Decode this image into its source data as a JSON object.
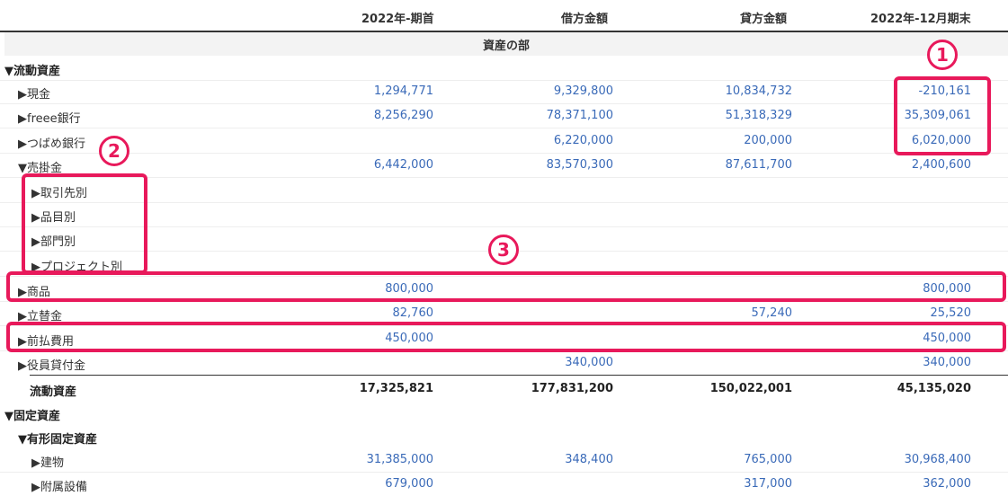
{
  "header": {
    "col1": "2022年-期首",
    "col2": "借方金額",
    "col3": "貸方金額",
    "col4": "2022年-12月期末"
  },
  "section_title": "資産の部",
  "rows": [
    {
      "label": "▼流動資産",
      "v1": "",
      "v2": "",
      "v3": "",
      "v4": ""
    },
    {
      "label": "▶現金",
      "v1": "1,294,771",
      "v2": "9,329,800",
      "v3": "10,834,732",
      "v4": "-210,161"
    },
    {
      "label": "▶freee銀行",
      "v1": "8,256,290",
      "v2": "78,371,100",
      "v3": "51,318,329",
      "v4": "35,309,061"
    },
    {
      "label": "▶つばめ銀行",
      "v1": "",
      "v2": "6,220,000",
      "v3": "200,000",
      "v4": "6,020,000"
    },
    {
      "label": "▼売掛金",
      "v1": "6,442,000",
      "v2": "83,570,300",
      "v3": "87,611,700",
      "v4": "2,400,600"
    },
    {
      "label": "▶取引先別",
      "v1": "",
      "v2": "",
      "v3": "",
      "v4": ""
    },
    {
      "label": "▶品目別",
      "v1": "",
      "v2": "",
      "v3": "",
      "v4": ""
    },
    {
      "label": "▶部門別",
      "v1": "",
      "v2": "",
      "v3": "",
      "v4": ""
    },
    {
      "label": "▶プロジェクト別",
      "v1": "",
      "v2": "",
      "v3": "",
      "v4": ""
    },
    {
      "label": "▶商品",
      "v1": "800,000",
      "v2": "",
      "v3": "",
      "v4": "800,000"
    },
    {
      "label": "▶立替金",
      "v1": "82,760",
      "v2": "",
      "v3": "57,240",
      "v4": "25,520"
    },
    {
      "label": "▶前払費用",
      "v1": "450,000",
      "v2": "",
      "v3": "",
      "v4": "450,000"
    },
    {
      "label": "▶役員貸付金",
      "v1": "",
      "v2": "340,000",
      "v3": "",
      "v4": "340,000"
    },
    {
      "label": "流動資産",
      "v1": "17,325,821",
      "v2": "177,831,200",
      "v3": "150,022,001",
      "v4": "45,135,020"
    },
    {
      "label": "▼固定資産",
      "v1": "",
      "v2": "",
      "v3": "",
      "v4": ""
    },
    {
      "label": "▼有形固定資産",
      "v1": "",
      "v2": "",
      "v3": "",
      "v4": ""
    },
    {
      "label": "▶建物",
      "v1": "31,385,000",
      "v2": "348,400",
      "v3": "765,000",
      "v4": "30,968,400"
    },
    {
      "label": "▶附属設備",
      "v1": "679,000",
      "v2": "",
      "v3": "317,000",
      "v4": "362,000"
    }
  ],
  "annotations": {
    "a1": "1",
    "a2": "2",
    "a3": "3"
  },
  "colors": {
    "accent": "#e8195b",
    "value_text": "#3a6ab8"
  }
}
